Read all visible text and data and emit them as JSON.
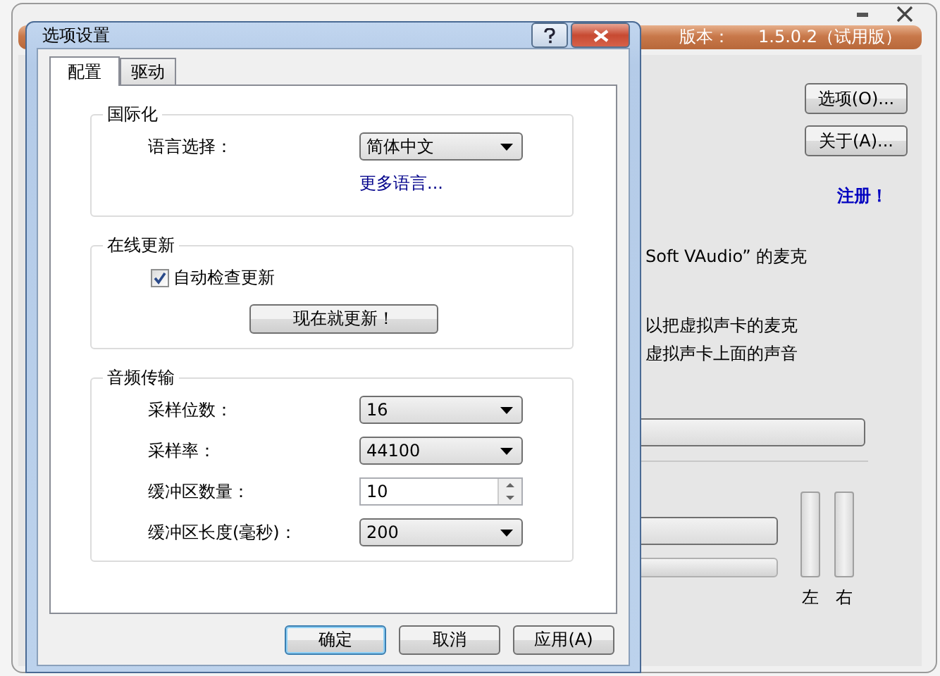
{
  "main_window": {
    "version_label": "版本：",
    "version": "1.5.0.2（试用版）",
    "buttons": [
      "选项(O)...",
      "关于(A)..."
    ],
    "register_link": "注册！",
    "text_lines": [
      "Soft VAudio” 的麦克",
      "以把虚拟声卡的麦克",
      "虚拟声卡上面的声音"
    ],
    "meters": [
      {
        "label": "左",
        "level": 0
      },
      {
        "label": "右",
        "level": 0
      }
    ]
  },
  "dialog": {
    "title": "选项设置",
    "tabs": [
      {
        "label": "配置",
        "selected": true
      },
      {
        "label": "驱动",
        "selected": false
      }
    ],
    "groups": [
      {
        "title": "国际化",
        "rows": [
          {
            "kind": "combo",
            "label": "语言选择：",
            "value": "简体中文"
          },
          {
            "kind": "link",
            "text": "更多语言..."
          }
        ]
      },
      {
        "title": "在线更新",
        "rows": [
          {
            "kind": "checkbox",
            "label": "自动检查更新",
            "checked": true
          },
          {
            "kind": "button",
            "text": "现在就更新！"
          }
        ]
      },
      {
        "title": "音频传输",
        "rows": [
          {
            "kind": "combo",
            "label": "采样位数：",
            "value": "16"
          },
          {
            "kind": "combo",
            "label": "采样率：",
            "value": "44100"
          },
          {
            "kind": "spin",
            "label": "缓冲区数量：",
            "value": "10"
          },
          {
            "kind": "combo",
            "label": "缓冲区长度(毫秒)：",
            "value": "200"
          }
        ]
      }
    ],
    "buttons": [
      {
        "label": "确定",
        "default": true
      },
      {
        "label": "取消",
        "default": false
      },
      {
        "label": "应用(A)",
        "default": false
      }
    ]
  }
}
